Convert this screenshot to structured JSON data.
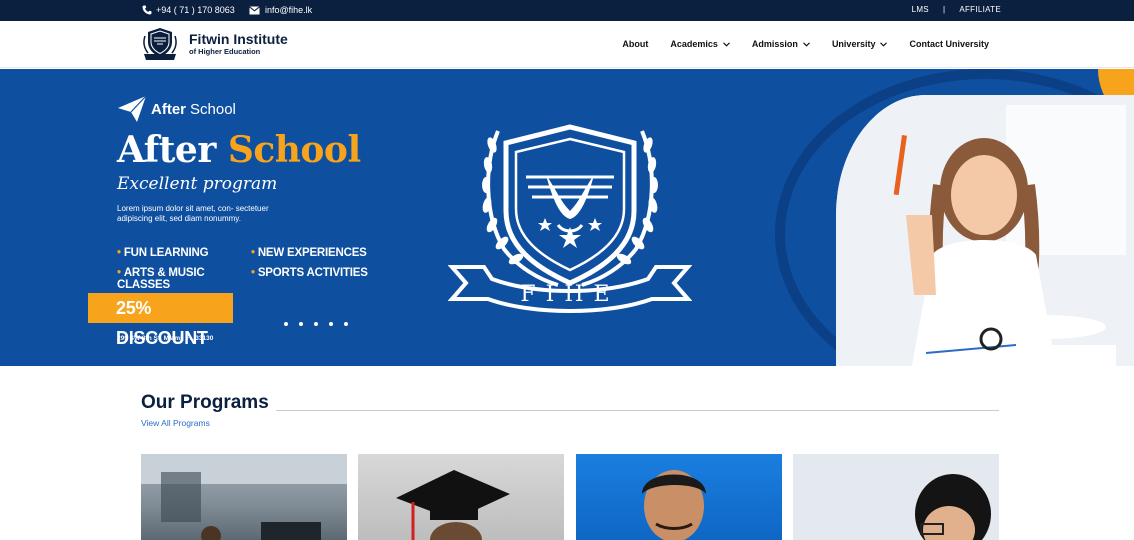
{
  "topbar": {
    "phone": "+94 ( 71 ) 170 8063",
    "email": "info@fihe.lk",
    "links": [
      "LMS",
      "|",
      "AFFILIATE"
    ]
  },
  "logo": {
    "name": "Fitwin Institute",
    "tagline": "of Higher Education"
  },
  "nav": {
    "about": "About",
    "academics": "Academics",
    "admission": "Admission",
    "university": "University",
    "contact": "Contact University"
  },
  "hero": {
    "brand_bold": "After",
    "brand_rest": " School",
    "headline_white": "After ",
    "headline_orange": "School",
    "subtitle": "Excellent program",
    "lorem": "Lorem ipsum dolor sit amet, con- sectetuer adipiscing elit, sed diam nonummy.",
    "features": [
      "FUN LEARNING",
      "NEW EXPERIENCES",
      "ARTS & MUSIC CLASSES",
      "SPORTS ACTIVITIES"
    ],
    "discount": "25% DISCOUNT",
    "address": "299 SW 8th St, Miami, FL 33130",
    "crest_text": "FIHE"
  },
  "programs": {
    "title": "Our Programs",
    "link": "View All Programs"
  },
  "colors": {
    "navy": "#0b1f3f",
    "hero_blue": "#0e4fa0",
    "accent_orange": "#f7a41c",
    "link_blue": "#2a6cc7"
  }
}
